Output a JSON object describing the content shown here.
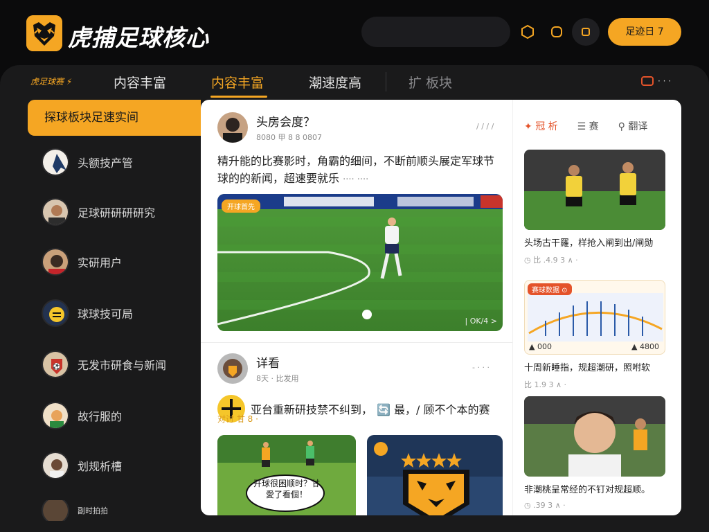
{
  "app": {
    "title": "虎捕足球核心",
    "cta_label": "足迹日 7",
    "icons": [
      "hexagon-icon",
      "hexagon-icon",
      "square-icon"
    ]
  },
  "tabs": {
    "brand": "虎足球赛 ⚡",
    "items": [
      {
        "label": "内容丰富",
        "active": false
      },
      {
        "label": "内容丰富",
        "active": true
      },
      {
        "label": "潮速度高",
        "active": false
      },
      {
        "label": "扩 板块",
        "active": false
      }
    ],
    "right_label": "· · ·"
  },
  "sidebar": {
    "active_label": "探球板块足速实间",
    "items": [
      {
        "label": "头额技产管"
      },
      {
        "label": "足球研研研研究"
      },
      {
        "label": "实研用户"
      },
      {
        "label": "球球技可局"
      },
      {
        "label": "无发市研食与新闻"
      },
      {
        "label": "故行服的"
      },
      {
        "label": "划规析槽"
      },
      {
        "label": "副时拍拍"
      }
    ]
  },
  "feed": {
    "post1": {
      "name": "头房会度？",
      "sub": "8080 甲 8 8 0807",
      "time": "/ / / /",
      "text": "精升能的比赛影时，角霸的细间，不断前顺头展定军球节球的的新闻，超速要就乐",
      "text_tail": "···· ····",
      "media_badge": "开球首先",
      "media_stat": "| OK/4 >"
    },
    "post2": {
      "name": "详看",
      "sub": "8天 · 比发用",
      "time": "- · · ·",
      "text": "亚台重新研技禁不纠到，",
      "text_tail": "🔄 最，/ 顾不个本的赛",
      "tag": "对讨 甘 8 ·"
    },
    "comic_bubble": "开球很困顺时？甘愛了看個！"
  },
  "right": {
    "tabs": [
      {
        "label": "冠 析",
        "icon": "fire-icon",
        "active": true
      },
      {
        "label": "赛",
        "icon": "chat-icon",
        "active": false
      },
      {
        "label": "翻译",
        "icon": "search-icon",
        "active": false
      }
    ],
    "cards": [
      {
        "title": "头场古干羅，样抢入闸到出/闸勋",
        "meta": "◷ 比 .4.9 3 ∧ ·"
      },
      {
        "title": "十周新睡指，规超潮研，照咐软",
        "meta": "比 1.9 3 ∧ ·",
        "chart_badge": "赛球数据 ⊙",
        "chart_left": "▲ 000",
        "chart_right": "▲ 4800"
      },
      {
        "title": "非潮桃呈常经的不钉对规超顺。",
        "meta": "◷ .39 3 ∧ ·"
      }
    ]
  },
  "colors": {
    "accent": "#f5a623",
    "background": "#0b0b0c",
    "panel": "#1a1a1b",
    "alert": "#e4532a"
  }
}
